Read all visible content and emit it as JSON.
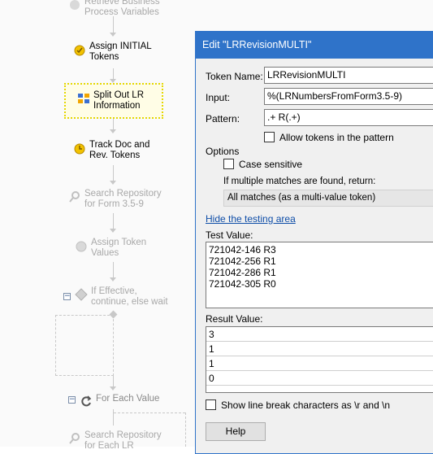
{
  "workflow": {
    "nodes": [
      {
        "id": "retrieve",
        "label": "Retrieve Business\nProcess Variables",
        "icon": "retrieve-variables-icon",
        "state": "dim"
      },
      {
        "id": "assign_initial",
        "label": "Assign INITIAL\nTokens",
        "icon": "assign-token-icon",
        "state": "normal"
      },
      {
        "id": "split_out",
        "label": "Split Out LR\nInformation",
        "icon": "split-tokens-icon",
        "state": "selected"
      },
      {
        "id": "track_doc",
        "label": "Track Doc and\nRev. Tokens",
        "icon": "track-tokens-icon",
        "state": "normal"
      },
      {
        "id": "search_repo",
        "label": "Search Repository\nfor Form 3.5-9",
        "icon": "search-icon",
        "state": "dim"
      },
      {
        "id": "assign_values",
        "label": "Assign Token\nValues",
        "icon": "assign-token-icon",
        "state": "dim"
      },
      {
        "id": "if_effective",
        "label": "If Effective,\ncontinue, else wait",
        "icon": "conditional-icon",
        "state": "dim"
      },
      {
        "id": "for_each_value",
        "label": "For Each Value",
        "icon": "loop-icon",
        "state": "dim-dark"
      },
      {
        "id": "search_each_lr",
        "label": "Search Repository\nfor Each LR",
        "icon": "search-icon",
        "state": "dim"
      }
    ]
  },
  "dialog": {
    "title": "Edit \"LRRevisionMULTI\"",
    "token_name_label": "Token Name:",
    "token_name_value": "LRRevisionMULTI",
    "input_label": "Input:",
    "input_value": "%(LRNumbersFromForm3.5-9)",
    "pattern_label": "Pattern:",
    "pattern_value": ".+ R(.+)",
    "allow_tokens_label": "Allow tokens in the pattern",
    "options_label": "Options",
    "case_sensitive_label": "Case sensitive",
    "multiple_matches_label": "If multiple matches are found, return:",
    "multiple_matches_value": "All matches (as a multi-value token)",
    "hide_testing_link": "Hide the testing area",
    "test_value_label": "Test Value:",
    "test_value_lines": [
      "721042-146 R3",
      "721042-256 R1",
      "721042-286 R1",
      "721042-305 R0"
    ],
    "result_value_label": "Result Value:",
    "result_values": [
      "3",
      "1",
      "1",
      "0"
    ],
    "show_line_breaks_label": "Show line break characters as \\r and \\n",
    "help_button": "Help"
  },
  "colors": {
    "titlebar": "#2f73c9",
    "selection": "#e6d800",
    "link": "#0f4ea8"
  }
}
